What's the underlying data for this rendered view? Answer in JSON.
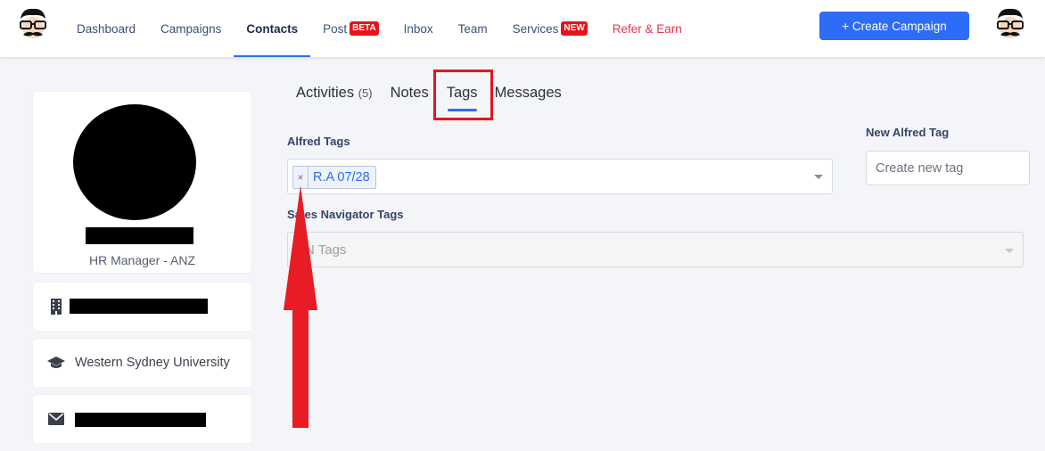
{
  "nav": {
    "items": [
      {
        "label": "Dashboard"
      },
      {
        "label": "Campaigns"
      },
      {
        "label": "Contacts"
      },
      {
        "label": "Post",
        "badge": "BETA"
      },
      {
        "label": "Inbox"
      },
      {
        "label": "Team"
      },
      {
        "label": "Services",
        "badge": "NEW"
      },
      {
        "label": "Refer & Earn"
      }
    ],
    "active": "Contacts",
    "create_button": "+ Create Campaign"
  },
  "profile": {
    "title": "HR Manager - ANZ",
    "school": "Western Sydney University"
  },
  "tabs": {
    "activities": "Activities",
    "activities_count": "(5)",
    "notes": "Notes",
    "tags": "Tags",
    "messages": "Messages",
    "active": "Tags"
  },
  "alfred_tags": {
    "label": "Alfred Tags",
    "selected": [
      "R.A 07/28"
    ]
  },
  "sales_nav_tags": {
    "label": "Sales Navigator Tags",
    "placeholder": "SN Tags"
  },
  "new_alfred_tag": {
    "label": "New Alfred Tag",
    "placeholder": "Create new tag"
  },
  "colors": {
    "accent": "#2d6cf6",
    "badge": "#e8131b",
    "refer": "#e8344e",
    "annotation": "#e4161f"
  }
}
